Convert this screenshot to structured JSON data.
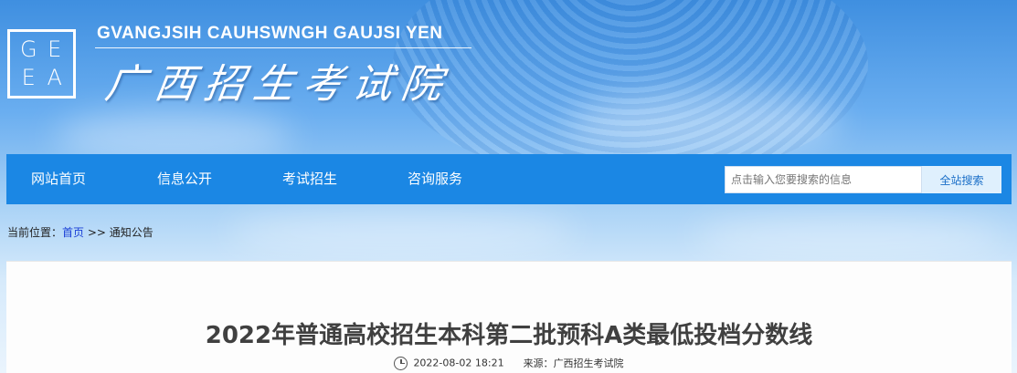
{
  "header": {
    "logo_letters": [
      "G",
      "E",
      "E",
      "A"
    ],
    "site_name_en": "GVANGJSIH CAUHSWNGH GAUJSI YEN",
    "site_name_cn": "广西招生考试院"
  },
  "nav": {
    "items": [
      {
        "label": "网站首页"
      },
      {
        "label": "信息公开"
      },
      {
        "label": "考试招生"
      },
      {
        "label": "咨询服务"
      }
    ],
    "search": {
      "placeholder": "点击输入您要搜索的信息",
      "button_label": "全站搜索"
    }
  },
  "breadcrumb": {
    "prefix": "当前位置：",
    "home": "首页",
    "separator": " >> ",
    "current": "通知公告"
  },
  "article": {
    "title": "2022年普通高校招生本科第二批预科A类最低投档分数线",
    "datetime": "2022-08-02 18:21",
    "source_label": "来源：",
    "source": "广西招生考试院"
  },
  "colors": {
    "nav_bg": "#1b87e4",
    "link": "#1a3fd6",
    "title": "#404040"
  }
}
